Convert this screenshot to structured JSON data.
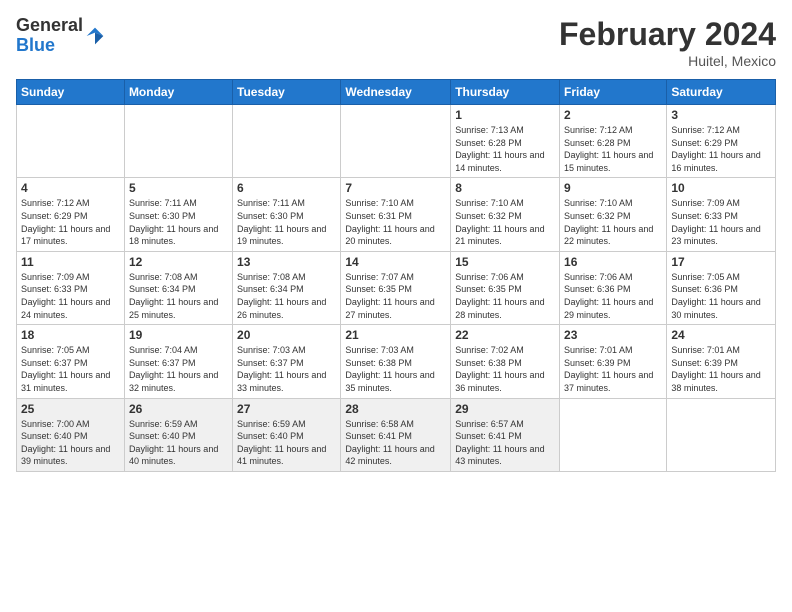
{
  "logo": {
    "general": "General",
    "blue": "Blue"
  },
  "title": "February 2024",
  "location": "Huitel, Mexico",
  "days_of_week": [
    "Sunday",
    "Monday",
    "Tuesday",
    "Wednesday",
    "Thursday",
    "Friday",
    "Saturday"
  ],
  "weeks": [
    [
      {
        "day": "",
        "info": ""
      },
      {
        "day": "",
        "info": ""
      },
      {
        "day": "",
        "info": ""
      },
      {
        "day": "",
        "info": ""
      },
      {
        "day": "1",
        "info": "Sunrise: 7:13 AM\nSunset: 6:28 PM\nDaylight: 11 hours and 14 minutes."
      },
      {
        "day": "2",
        "info": "Sunrise: 7:12 AM\nSunset: 6:28 PM\nDaylight: 11 hours and 15 minutes."
      },
      {
        "day": "3",
        "info": "Sunrise: 7:12 AM\nSunset: 6:29 PM\nDaylight: 11 hours and 16 minutes."
      }
    ],
    [
      {
        "day": "4",
        "info": "Sunrise: 7:12 AM\nSunset: 6:29 PM\nDaylight: 11 hours and 17 minutes."
      },
      {
        "day": "5",
        "info": "Sunrise: 7:11 AM\nSunset: 6:30 PM\nDaylight: 11 hours and 18 minutes."
      },
      {
        "day": "6",
        "info": "Sunrise: 7:11 AM\nSunset: 6:30 PM\nDaylight: 11 hours and 19 minutes."
      },
      {
        "day": "7",
        "info": "Sunrise: 7:10 AM\nSunset: 6:31 PM\nDaylight: 11 hours and 20 minutes."
      },
      {
        "day": "8",
        "info": "Sunrise: 7:10 AM\nSunset: 6:32 PM\nDaylight: 11 hours and 21 minutes."
      },
      {
        "day": "9",
        "info": "Sunrise: 7:10 AM\nSunset: 6:32 PM\nDaylight: 11 hours and 22 minutes."
      },
      {
        "day": "10",
        "info": "Sunrise: 7:09 AM\nSunset: 6:33 PM\nDaylight: 11 hours and 23 minutes."
      }
    ],
    [
      {
        "day": "11",
        "info": "Sunrise: 7:09 AM\nSunset: 6:33 PM\nDaylight: 11 hours and 24 minutes."
      },
      {
        "day": "12",
        "info": "Sunrise: 7:08 AM\nSunset: 6:34 PM\nDaylight: 11 hours and 25 minutes."
      },
      {
        "day": "13",
        "info": "Sunrise: 7:08 AM\nSunset: 6:34 PM\nDaylight: 11 hours and 26 minutes."
      },
      {
        "day": "14",
        "info": "Sunrise: 7:07 AM\nSunset: 6:35 PM\nDaylight: 11 hours and 27 minutes."
      },
      {
        "day": "15",
        "info": "Sunrise: 7:06 AM\nSunset: 6:35 PM\nDaylight: 11 hours and 28 minutes."
      },
      {
        "day": "16",
        "info": "Sunrise: 7:06 AM\nSunset: 6:36 PM\nDaylight: 11 hours and 29 minutes."
      },
      {
        "day": "17",
        "info": "Sunrise: 7:05 AM\nSunset: 6:36 PM\nDaylight: 11 hours and 30 minutes."
      }
    ],
    [
      {
        "day": "18",
        "info": "Sunrise: 7:05 AM\nSunset: 6:37 PM\nDaylight: 11 hours and 31 minutes."
      },
      {
        "day": "19",
        "info": "Sunrise: 7:04 AM\nSunset: 6:37 PM\nDaylight: 11 hours and 32 minutes."
      },
      {
        "day": "20",
        "info": "Sunrise: 7:03 AM\nSunset: 6:37 PM\nDaylight: 11 hours and 33 minutes."
      },
      {
        "day": "21",
        "info": "Sunrise: 7:03 AM\nSunset: 6:38 PM\nDaylight: 11 hours and 35 minutes."
      },
      {
        "day": "22",
        "info": "Sunrise: 7:02 AM\nSunset: 6:38 PM\nDaylight: 11 hours and 36 minutes."
      },
      {
        "day": "23",
        "info": "Sunrise: 7:01 AM\nSunset: 6:39 PM\nDaylight: 11 hours and 37 minutes."
      },
      {
        "day": "24",
        "info": "Sunrise: 7:01 AM\nSunset: 6:39 PM\nDaylight: 11 hours and 38 minutes."
      }
    ],
    [
      {
        "day": "25",
        "info": "Sunrise: 7:00 AM\nSunset: 6:40 PM\nDaylight: 11 hours and 39 minutes."
      },
      {
        "day": "26",
        "info": "Sunrise: 6:59 AM\nSunset: 6:40 PM\nDaylight: 11 hours and 40 minutes."
      },
      {
        "day": "27",
        "info": "Sunrise: 6:59 AM\nSunset: 6:40 PM\nDaylight: 11 hours and 41 minutes."
      },
      {
        "day": "28",
        "info": "Sunrise: 6:58 AM\nSunset: 6:41 PM\nDaylight: 11 hours and 42 minutes."
      },
      {
        "day": "29",
        "info": "Sunrise: 6:57 AM\nSunset: 6:41 PM\nDaylight: 11 hours and 43 minutes."
      },
      {
        "day": "",
        "info": ""
      },
      {
        "day": "",
        "info": ""
      }
    ]
  ]
}
